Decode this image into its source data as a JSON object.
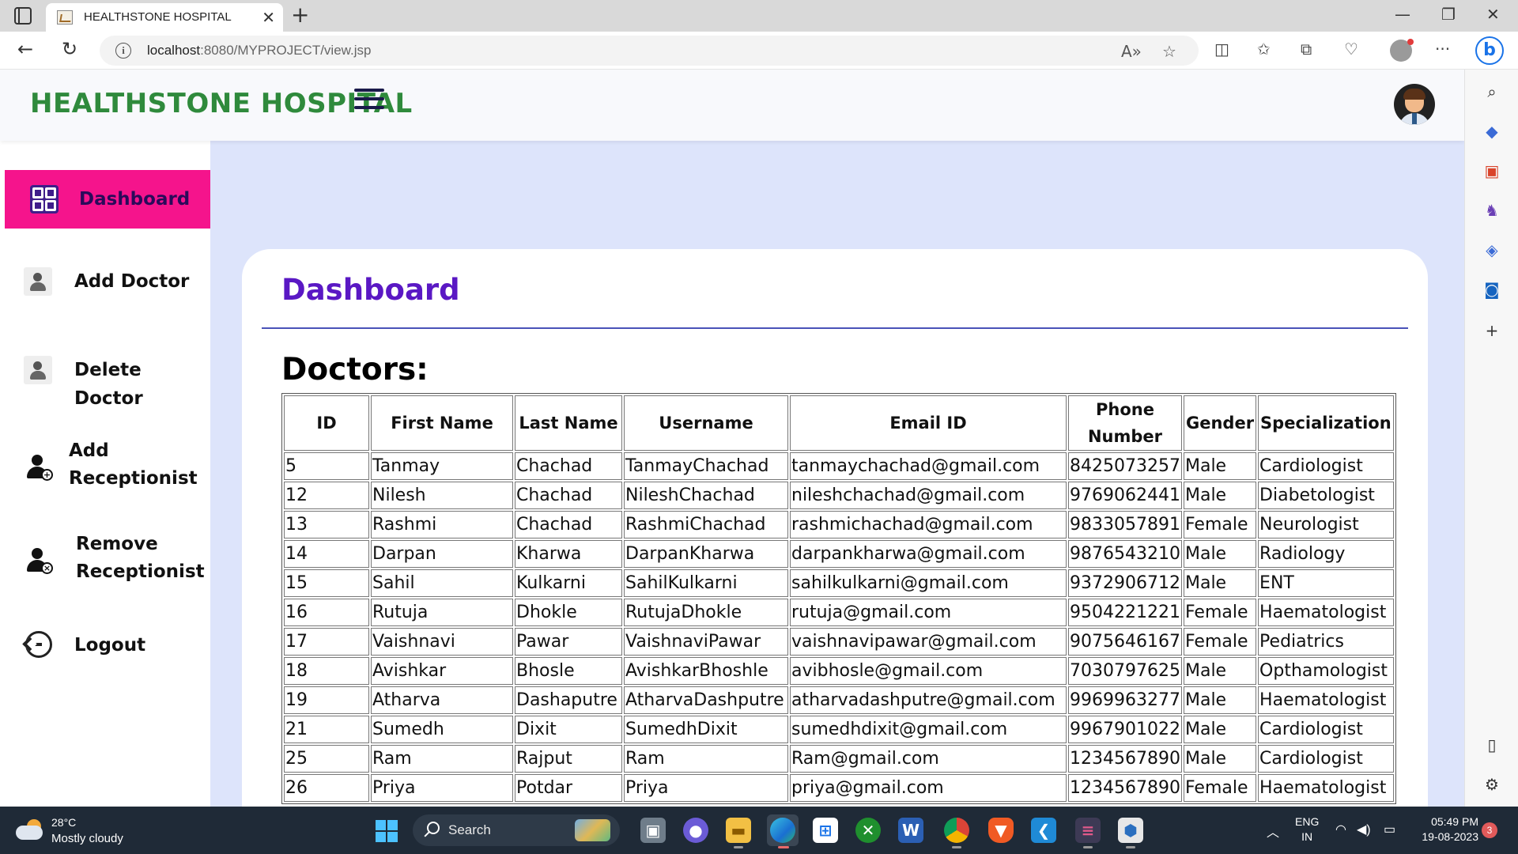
{
  "browser": {
    "tab_title": "HEALTHSTONE HOSPITAL",
    "url_host": "localhost",
    "url_rest": ":8080/MYPROJECT/view.jsp"
  },
  "header": {
    "brand": "HEALTHSTONE HOSPITAL"
  },
  "sidebar": {
    "items": [
      {
        "label": "Dashboard",
        "icon": "dashboard-icon",
        "active": true
      },
      {
        "label": "Add Doctor",
        "icon": "doctor-icon"
      },
      {
        "label": "Delete Doctor",
        "icon": "doctor-icon"
      },
      {
        "label": "Add Receptionist",
        "label_lines": [
          "Add",
          "Receptionist"
        ],
        "icon": "add-receptionist-icon"
      },
      {
        "label": "Remove Receptionist",
        "label_lines": [
          "Remove",
          "Receptionist"
        ],
        "icon": "remove-receptionist-icon"
      },
      {
        "label": "Logout",
        "icon": "logout-icon"
      }
    ]
  },
  "main": {
    "title": "Dashboard",
    "section_title": "Doctors:",
    "table": {
      "columns": [
        "ID",
        "First Name",
        "Last Name",
        "Username",
        "Email ID",
        "Phone Number",
        "Gender",
        "Specialization"
      ],
      "rows": [
        [
          "5",
          "Tanmay",
          "Chachad",
          "TanmayChachad",
          "tanmaychachad@gmail.com",
          "8425073257",
          "Male",
          "Cardiologist"
        ],
        [
          "12",
          "Nilesh",
          "Chachad",
          "NileshChachad",
          "nileshchachad@gmail.com",
          "9769062441",
          "Male",
          "Diabetologist"
        ],
        [
          "13",
          "Rashmi",
          "Chachad",
          "RashmiChachad",
          "rashmichachad@gmail.com",
          "9833057891",
          "Female",
          "Neurologist"
        ],
        [
          "14",
          "Darpan",
          "Kharwa",
          "DarpanKharwa",
          "darpankharwa@gmail.com",
          "9876543210",
          "Male",
          "Radiology"
        ],
        [
          "15",
          "Sahil",
          "Kulkarni",
          "SahilKulkarni",
          "sahilkulkarni@gmail.com",
          "9372906712",
          "Male",
          "ENT"
        ],
        [
          "16",
          "Rutuja",
          "Dhokle",
          "RutujaDhokle",
          "rutuja@gmail.com",
          "9504221221",
          "Female",
          "Haematologist"
        ],
        [
          "17",
          "Vaishnavi",
          "Pawar",
          "VaishnaviPawar",
          "vaishnavipawar@gmail.com",
          "9075646167",
          "Female",
          "Pediatrics"
        ],
        [
          "18",
          "Avishkar",
          "Bhosle",
          "AvishkarBhoshle",
          "avibhosle@gmail.com",
          "7030797625",
          "Male",
          "Opthamologist"
        ],
        [
          "19",
          "Atharva",
          "Dashaputre",
          "AtharvaDashputre",
          "atharvadashputre@gmail.com",
          "9969963277",
          "Male",
          "Haematologist"
        ],
        [
          "21",
          "Sumedh",
          "Dixit",
          "SumedhDixit",
          "sumedhdixit@gmail.com",
          "9967901022",
          "Male",
          "Cardiologist"
        ],
        [
          "25",
          "Ram",
          "Rajput",
          "Ram",
          "Ram@gmail.com",
          "1234567890",
          "Male",
          "Cardiologist"
        ],
        [
          "26",
          "Priya",
          "Potdar",
          "Priya",
          "priya@gmail.com",
          "1234567890",
          "Female",
          "Haematologist"
        ]
      ]
    }
  },
  "taskbar": {
    "weather_temp": "28°C",
    "weather_desc": "Mostly cloudy",
    "search_label": "Search",
    "lang_line1": "ENG",
    "lang_line2": "IN",
    "time": "05:49 PM",
    "date": "19-08-2023",
    "notifications": "3"
  },
  "colors": {
    "brand_green": "#2f8a3c",
    "active_pink": "#f5148c",
    "title_purple": "#5a18c4",
    "page_bg": "#dde4fb"
  }
}
